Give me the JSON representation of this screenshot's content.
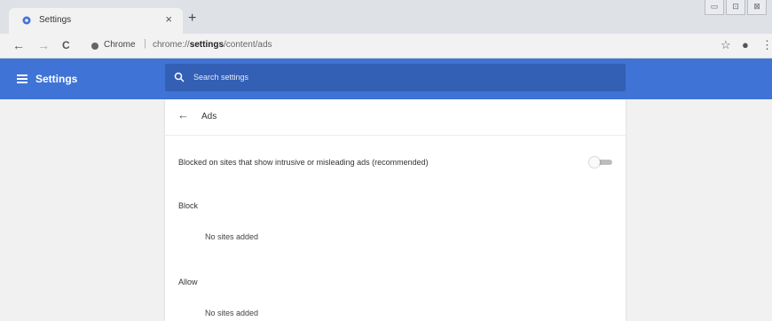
{
  "browser": {
    "tab": {
      "title": "Settings",
      "close": "×"
    },
    "new_tab": "+",
    "window_controls": [
      "▭",
      "⊡",
      "⊠"
    ],
    "nav": {
      "back": "←",
      "forward": "→",
      "reload": "C"
    },
    "omnibox": {
      "chip": "Chrome",
      "separator": "|",
      "url_prefix": "chrome://",
      "url_bold": "settings",
      "url_suffix": "/content/ads"
    },
    "toolbar_right": {
      "bookmark": "☆",
      "profile": "●",
      "menu": "⋮"
    }
  },
  "header": {
    "title": "Settings",
    "search": {
      "placeholder": "Search settings"
    },
    "colors": {
      "bar": "#3f73d6",
      "search": "#335fb4"
    }
  },
  "ads_page": {
    "back": "←",
    "title": "Ads",
    "setting": {
      "label": "Blocked on sites that show intrusive or misleading ads (recommended)",
      "enabled": false
    },
    "block": {
      "heading": "Block",
      "empty": "No sites added"
    },
    "allow": {
      "heading": "Allow",
      "empty": "No sites added"
    }
  }
}
